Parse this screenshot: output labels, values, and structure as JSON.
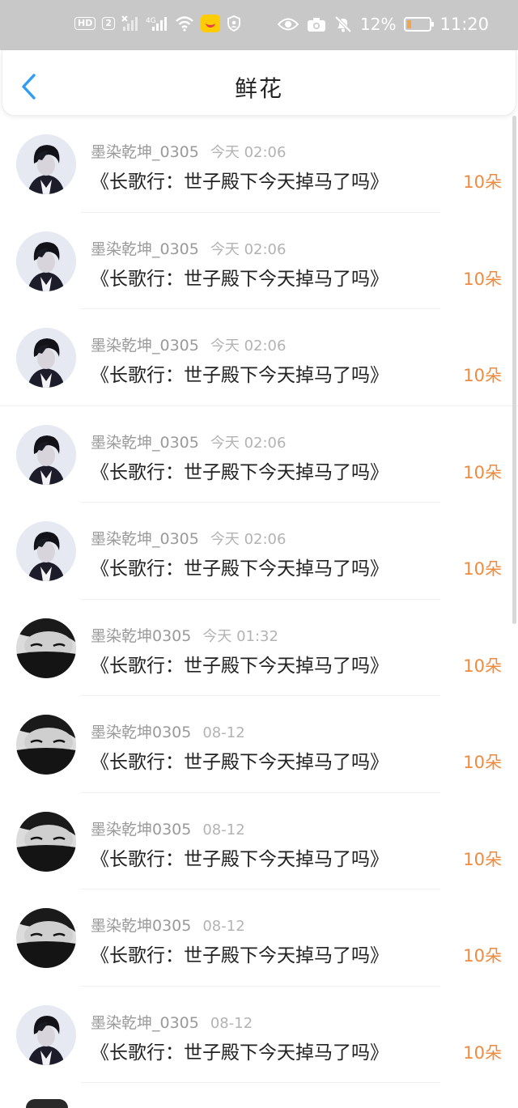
{
  "status_bar": {
    "hd": "HD",
    "sim": "2",
    "network": "4G",
    "battery": "12%",
    "time": "11:20"
  },
  "header": {
    "title": "鲜花"
  },
  "items": [
    {
      "user": "墨染乾坤_0305",
      "time": "今天 02:06",
      "book": "《长歌行：世子殿下今天掉马了吗》",
      "count": "10朵",
      "avatar": "light"
    },
    {
      "user": "墨染乾坤_0305",
      "time": "今天 02:06",
      "book": "《长歌行：世子殿下今天掉马了吗》",
      "count": "10朵",
      "avatar": "light"
    },
    {
      "user": "墨染乾坤_0305",
      "time": "今天 02:06",
      "book": "《长歌行：世子殿下今天掉马了吗》",
      "count": "10朵",
      "avatar": "light"
    },
    {
      "user": "墨染乾坤_0305",
      "time": "今天 02:06",
      "book": "《长歌行：世子殿下今天掉马了吗》",
      "count": "10朵",
      "avatar": "light"
    },
    {
      "user": "墨染乾坤_0305",
      "time": "今天 02:06",
      "book": "《长歌行：世子殿下今天掉马了吗》",
      "count": "10朵",
      "avatar": "light"
    },
    {
      "user": "墨染乾坤0305",
      "time": "今天 01:32",
      "book": "《长歌行：世子殿下今天掉马了吗》",
      "count": "10朵",
      "avatar": "dark"
    },
    {
      "user": "墨染乾坤0305",
      "time": "08-12",
      "book": "《长歌行：世子殿下今天掉马了吗》",
      "count": "10朵",
      "avatar": "dark"
    },
    {
      "user": "墨染乾坤0305",
      "time": "08-12",
      "book": "《长歌行：世子殿下今天掉马了吗》",
      "count": "10朵",
      "avatar": "dark"
    },
    {
      "user": "墨染乾坤0305",
      "time": "08-12",
      "book": "《长歌行：世子殿下今天掉马了吗》",
      "count": "10朵",
      "avatar": "dark"
    },
    {
      "user": "墨染乾坤_0305",
      "time": "08-12",
      "book": "《长歌行：世子殿下今天掉马了吗》",
      "count": "10朵",
      "avatar": "light"
    }
  ],
  "colors": {
    "accent": "#f08a3c",
    "back_arrow": "#2f9df4"
  }
}
